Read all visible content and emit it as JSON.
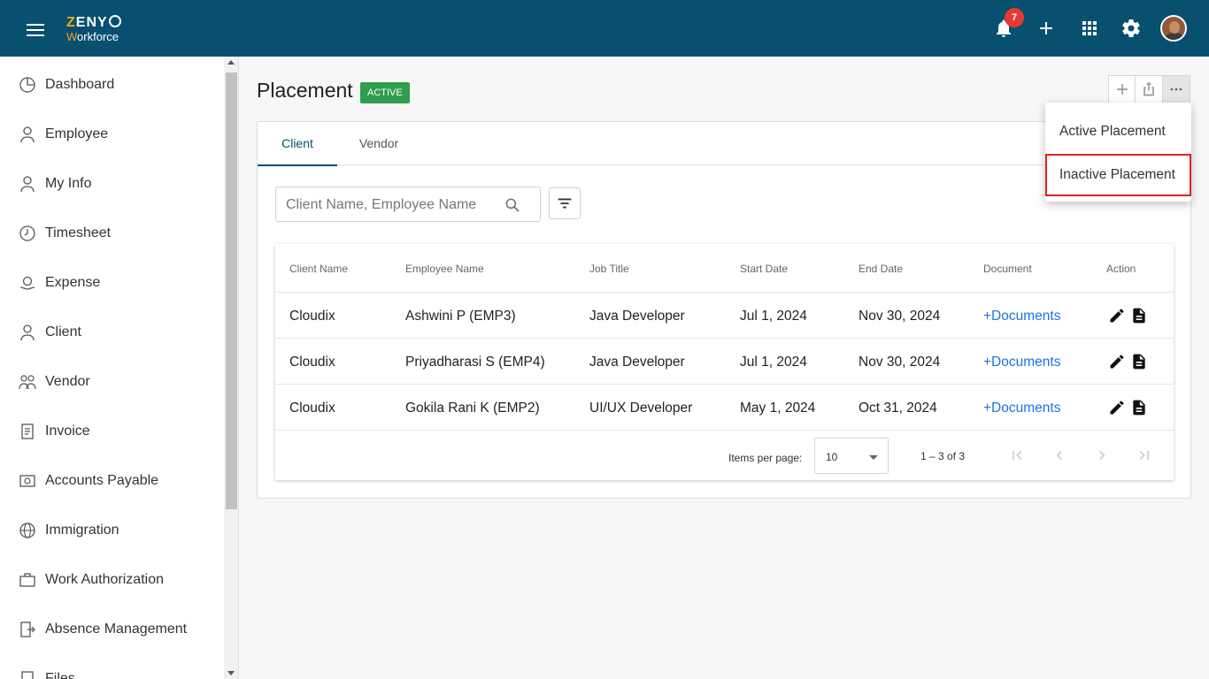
{
  "app": {
    "logo_line1_a": "Z",
    "logo_line1_b": "ENY",
    "logo_line2_a": "W",
    "logo_line2_b": "orkforce",
    "notification_count": "7",
    "icons": [
      "menu-icon",
      "bell-icon",
      "plus-icon",
      "apps-grid-icon",
      "gear-icon"
    ]
  },
  "sidebar": {
    "items": [
      {
        "label": "Dashboard",
        "icon": "dashboard-icon"
      },
      {
        "label": "Employee",
        "icon": "employee-icon"
      },
      {
        "label": "My Info",
        "icon": "my-info-icon"
      },
      {
        "label": "Timesheet",
        "icon": "clock-icon"
      },
      {
        "label": "Expense",
        "icon": "expense-icon"
      },
      {
        "label": "Client",
        "icon": "client-icon"
      },
      {
        "label": "Vendor",
        "icon": "vendor-icon"
      },
      {
        "label": "Invoice",
        "icon": "invoice-icon"
      },
      {
        "label": "Accounts Payable",
        "icon": "accounts-payable-icon"
      },
      {
        "label": "Immigration",
        "icon": "globe-icon"
      },
      {
        "label": "Work Authorization",
        "icon": "briefcase-icon"
      },
      {
        "label": "Absence Management",
        "icon": "exit-door-icon"
      },
      {
        "label": "Files",
        "icon": "files-icon"
      }
    ]
  },
  "page": {
    "title": "Placement",
    "status": "ACTIVE",
    "status_color": "#2e9e4f"
  },
  "tabs": [
    {
      "label": "Client",
      "active": true
    },
    {
      "label": "Vendor",
      "active": false
    }
  ],
  "search": {
    "placeholder": "Client Name, Employee Name",
    "value": ""
  },
  "table": {
    "headers": [
      "Client Name",
      "Employee Name",
      "Job Title",
      "Start Date",
      "End Date",
      "Document",
      "Action"
    ],
    "rows": [
      {
        "client": "Cloudix",
        "employee": "Ashwini P (EMP3)",
        "job": "Java Developer",
        "start": "Jul 1, 2024",
        "end": "Nov 30, 2024",
        "doc": "+Documents"
      },
      {
        "client": "Cloudix",
        "employee": "Priyadharasi S (EMP4)",
        "job": "Java Developer",
        "start": "Jul 1, 2024",
        "end": "Nov 30, 2024",
        "doc": "+Documents"
      },
      {
        "client": "Cloudix",
        "employee": "Gokila Rani K (EMP2)",
        "job": "UI/UX Developer",
        "start": "May 1, 2024",
        "end": "Oct 31, 2024",
        "doc": "+Documents"
      }
    ]
  },
  "pagination": {
    "items_per_page_label": "Items per page:",
    "items_per_page_value": "10",
    "range": "1 – 3 of 3"
  },
  "menu": {
    "items": [
      {
        "label": "Active Placement"
      },
      {
        "label": "Inactive Placement"
      }
    ]
  },
  "colors": {
    "topbar": "#07506f",
    "accent": "#f5a524",
    "link": "#1a73e8",
    "highlight_outline": "#e02020"
  }
}
